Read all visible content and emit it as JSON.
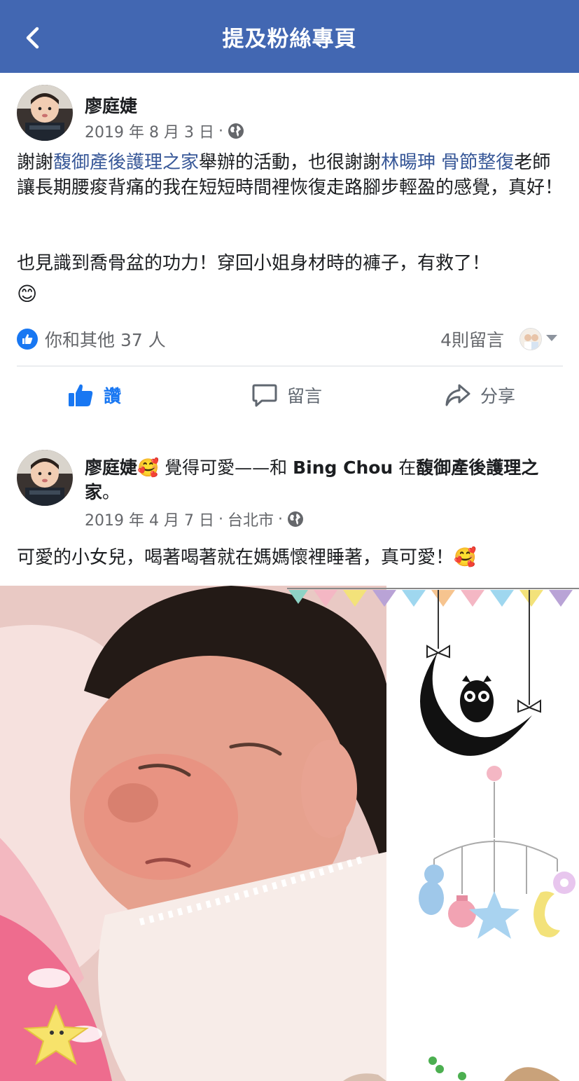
{
  "header": {
    "title": "提及粉絲專頁",
    "background": "#4267b2"
  },
  "post1": {
    "author": "廖庭婕",
    "date": "2019 年 8 月 3 日",
    "separator": "·",
    "text_a": "謝謝",
    "link1": "馥御產後護理之家",
    "text_b": "舉辦的活動，也很謝謝",
    "link2": "林暘珅 骨節整復",
    "text_c": "老師讓長期腰痠背痛的我在短短時間裡恢復走路腳步輕盈的感覺，真好！",
    "paragraph2": "也見識到喬骨盆的功力！穿回小姐身材時的褲子，有救了！",
    "emoji": "😊",
    "reactions": "你和其他 37 人",
    "comments": "4則留言",
    "actions": {
      "like": "讚",
      "comment": "留言",
      "share": "分享"
    }
  },
  "post2": {
    "author": "廖庭婕",
    "feeling_emoji": "🥰",
    "feeling": "覺得可愛",
    "dash": "——",
    "with_word": "和",
    "tagged": "Bing Chou",
    "at_word": "在",
    "place": "馥御產後護理之家",
    "period": "。",
    "date": "2019 年 4 月 7 日",
    "separator": "·",
    "location": "台北市",
    "text": "可愛的小女兒，喝著喝著就在媽媽懷裡睡著，真可愛！",
    "text_emoji": "🥰"
  },
  "colors": {
    "link": "#385898",
    "like_blue": "#1877f2",
    "meta_gray": "#65676b"
  }
}
